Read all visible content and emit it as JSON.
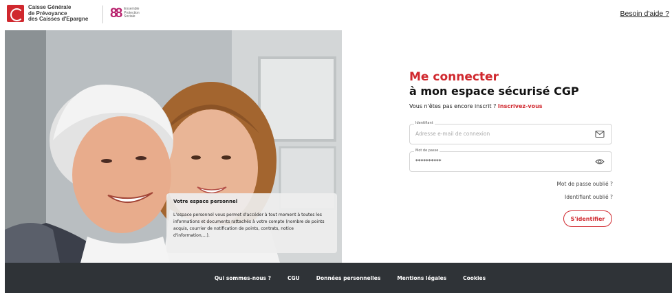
{
  "header": {
    "brand_lines": [
      "Caisse Générale",
      "de Prévoyance",
      "des Caisses d'Epargne"
    ],
    "partner_mark": "88",
    "partner_lines": [
      "Ensemble",
      "Protection",
      "Sociale"
    ],
    "help_link": "Besoin d'aide ?"
  },
  "hero": {
    "card_title": "Votre espace personnel",
    "card_text": "L'espace personnel vous permet d'accéder à tout moment à toutes les informations et documents rattachés à votre compte (nombre de points acquis, courrier de notification de points, contrats, notice d'information,...)."
  },
  "login": {
    "title_line1": "Me connecter",
    "title_line2": "à mon espace sécurisé CGP",
    "subtitle_text": "Vous n'êtes pas encore inscrit ?",
    "signup_link": "Inscrivez-vous",
    "identifier_label": "Identifiant",
    "identifier_placeholder": "Adresse e-mail de connexion",
    "password_label": "Mot de passe",
    "password_value": "**********",
    "forgot_password": "Mot de passe oublié ?",
    "forgot_identifier": "Identifiant oublié ?",
    "submit_label": "S'identifier"
  },
  "footer": {
    "links": [
      "Qui sommes-nous ?",
      "CGU",
      "Données personnelles",
      "Mentions légales",
      "Cookies"
    ]
  },
  "colors": {
    "accent": "#d0282e",
    "partner": "#b8236e",
    "footer_bg": "#2f3337"
  }
}
